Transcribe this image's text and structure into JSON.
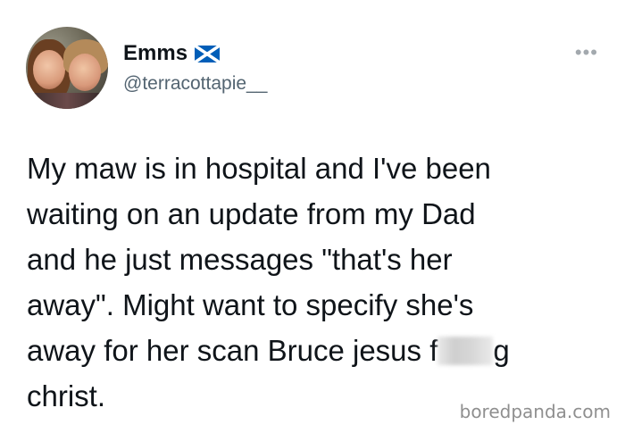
{
  "tweet": {
    "author": {
      "display_name": "Emms",
      "handle": "@terracottapie__",
      "flag_icon": "scotland-flag-icon"
    },
    "more_icon": "more-options-icon",
    "lines": {
      "l1": "My maw is in hospital and I've been",
      "l2": "waiting on an update from my Dad",
      "l3": "and he just messages \"that's her",
      "l4": "away\". Might want to specify she's",
      "l5_before": "away for her scan Bruce jesus f",
      "l5_after": "g",
      "l6": "christ."
    }
  },
  "watermark": "boredpanda.com",
  "colors": {
    "text": "#0f1419",
    "secondary": "#536471",
    "flag_blue": "#005eb8",
    "watermark": "#8f8f8f"
  }
}
